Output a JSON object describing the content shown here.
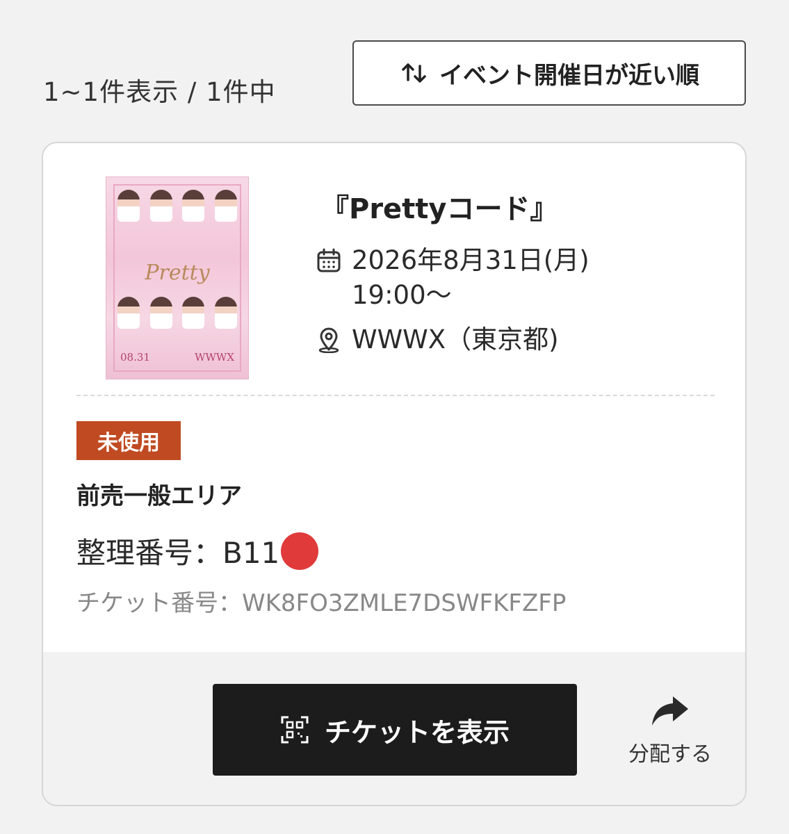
{
  "header": {
    "result_count": "1~1件表示 / 1件中",
    "sort_label": "イベント開催日が近い順"
  },
  "event": {
    "poster": {
      "title_text": "Pretty",
      "date_text": "08.31",
      "venue_text": "WWWX"
    },
    "title": "『Prettyコード』",
    "date_line1": "2026年8月31日(月)",
    "date_line2": "19:00〜",
    "venue": "WWWX（東京都)"
  },
  "ticket": {
    "status": "未使用",
    "area": "前売一般エリア",
    "seat_number": "整理番号：B11",
    "ticket_number": "チケット番号：WK8FO3ZMLE7DSWFKFZFP"
  },
  "actions": {
    "show_ticket_label": "チケットを表示",
    "share_label": "分配する"
  },
  "colors": {
    "status_badge": "#c04a22",
    "primary_button": "#1c1c1c",
    "redaction_dot": "#e03a3a"
  }
}
